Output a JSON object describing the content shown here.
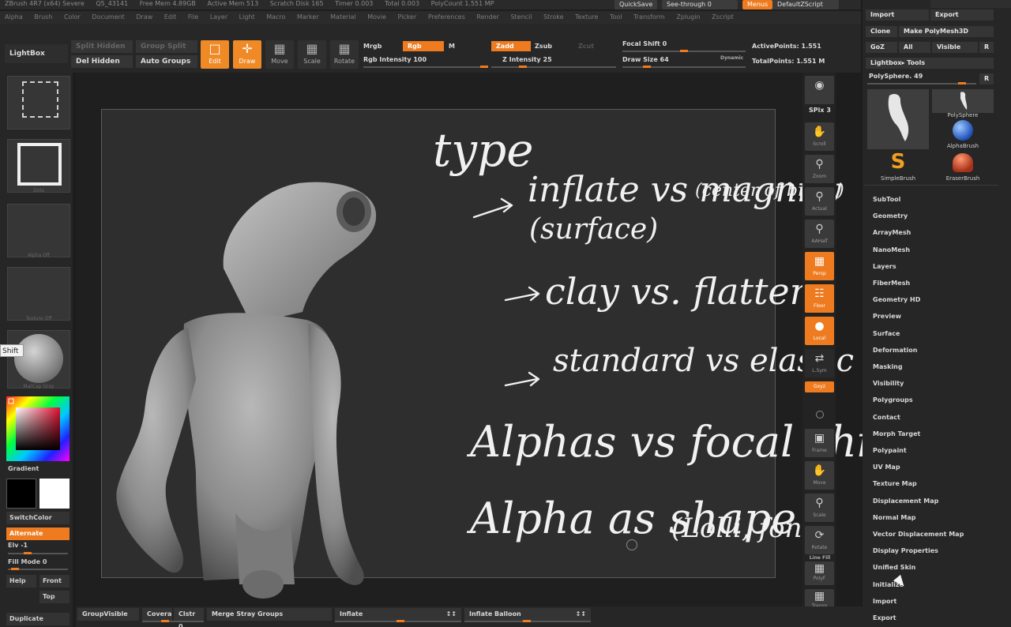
{
  "menubar": {
    "items": [
      "ZBrush 4R7 (x64) Severe",
      "Q5_43141",
      "Free Mem 4.89GB",
      "Active Mem 513",
      "Scratch Disk 165",
      "Timer 0.003",
      "Total 0.003",
      "PolyCount 1.551 MP"
    ],
    "menus": [
      "Alpha",
      "Brush",
      "Color",
      "Document",
      "Draw",
      "Edit",
      "File",
      "Layer",
      "Light",
      "Macro",
      "Marker",
      "Material",
      "Movie",
      "Picker",
      "Preferences",
      "Render",
      "Stencil",
      "Stroke",
      "Texture",
      "Tool",
      "Transform",
      "Zplugin",
      "Zscript"
    ],
    "quicksave": "QuickSave",
    "seethrough": "See-through   0",
    "menus_btn": "Menus",
    "script": "DefaultZScript"
  },
  "toolbar": {
    "lightbox": "LightBox",
    "split_hidden": "Split Hidden",
    "del_hidden": "Del Hidden",
    "group_split": "Group Split",
    "auto_groups": "Auto Groups",
    "edit": "Edit",
    "draw": "Draw",
    "move": "Move",
    "scale": "Scale",
    "rotate": "Rotate",
    "mrgb": "Mrgb",
    "rgb": "Rgb",
    "m": "M",
    "rgb_intensity": "Rgb Intensity 100",
    "zadd": "Zadd",
    "zsub": "Zsub",
    "zcut": "Zcut",
    "z_intensity": "Z Intensity 25",
    "focal_shift": "Focal Shift 0",
    "draw_size": "Draw Size 64",
    "dynamic": "Dynamic",
    "active_points": "ActivePoints: 1.551",
    "total_points": "TotalPoints: 1.551 M",
    "rgb_intensity_value": 1.0,
    "z_intensity_value": 0.25,
    "focal_shift_value": 0.5,
    "draw_size_value": 0.2
  },
  "leftshelf": {
    "tooltip": "Shift",
    "brush_cap": "Alpha Off",
    "stroke_cap": "Dots",
    "alpha_cap": "Alpha Off",
    "texture_cap": "Texture Off",
    "material_cap": "MatCap Gray",
    "gradient": "Gradient",
    "switchcolor": "SwitchColor",
    "alternate": "Alternate",
    "elv": "Elv -1",
    "fill_mode": "Fill Mode 0",
    "help": "Help",
    "front": "Front",
    "top": "Top",
    "duplicate": "Duplicate"
  },
  "viewport_tools": [
    {
      "label": "SPix 3",
      "icon": "bpr-icon"
    },
    {
      "label": "Scroll",
      "icon": "scroll-icon"
    },
    {
      "label": "Zoom",
      "icon": "zoom-icon"
    },
    {
      "label": "Actual",
      "icon": "actual-icon"
    },
    {
      "label": "AAHalf",
      "icon": "aahalf-icon"
    },
    {
      "label": "Persp",
      "icon": "persp-icon"
    },
    {
      "label": "Floor",
      "icon": "floor-icon"
    },
    {
      "label": "Local",
      "icon": "local-icon"
    },
    {
      "label": "L.Sym",
      "icon": "lsym-icon"
    },
    {
      "label": "Gxyz",
      "icon": "gxyz-icon"
    },
    {
      "label": "Frame",
      "icon": "frame-icon"
    },
    {
      "label": "Move",
      "icon": "move-icon"
    },
    {
      "label": "Scale",
      "icon": "scale-icon"
    },
    {
      "label": "Rotate",
      "icon": "rotate-icon"
    },
    {
      "label": "Line Fill",
      "icon": "linefill-icon"
    },
    {
      "label": "PolyF",
      "icon": "polyf-icon"
    },
    {
      "label": "Transp",
      "icon": "transp-icon"
    }
  ],
  "toolpanel": {
    "import": "Import",
    "export": "Export",
    "clone": "Clone",
    "make_polymesh": "Make PolyMesh3D",
    "goz": "GoZ",
    "all": "All",
    "visible": "Visible",
    "r": "R",
    "lightbox_tools": "Lightbox▸ Tools",
    "polysphere": "PolySphere. 49",
    "tools": [
      {
        "name": "PolySphere",
        "icon": "figure-tool-icon"
      },
      {
        "name": "PolySphere",
        "icon": "figure-small-icon"
      },
      {
        "name": "AlphaBrush",
        "icon": "alphabrush-icon"
      },
      {
        "name": "SimpleBrush",
        "icon": "simplebrush-icon"
      },
      {
        "name": "EraserBrush",
        "icon": "eraserbrush-icon"
      }
    ],
    "subpalettes": [
      "SubTool",
      "Geometry",
      "ArrayMesh",
      "NanoMesh",
      "Layers",
      "FiberMesh",
      "Geometry HD",
      "Preview",
      "Surface",
      "Deformation",
      "Masking",
      "Visibility",
      "Polygroups",
      "Contact",
      "Morph Target",
      "Polypaint",
      "UV Map",
      "Texture Map",
      "Displacement Map",
      "Normal Map",
      "Vector Displacement Map",
      "Display Properties",
      "Unified Skin",
      "Initialize",
      "Import",
      "Export"
    ]
  },
  "bottombar": {
    "groupvisible": "GroupVisible",
    "coverage": "Covera",
    "clstr": "Clstr 0.",
    "merge_stray": "Merge Stray Groups",
    "inflate": "Inflate",
    "inflate_balloon": "Inflate Balloon",
    "arrows": "↕↕"
  },
  "notes": {
    "line1": "type",
    "line2a": "inflate vs magnify",
    "line2b": "(surface)",
    "line2c": "(center of brush)",
    "line3": "clay vs. flatten",
    "line4": "standard vs elastic",
    "line5": "Alphas vs focal shift",
    "line6a": "Alpha as shape",
    "line6b": "(Lolli, font)"
  },
  "colors": {
    "accent": "#ee7b1f",
    "panel": "#262626",
    "canvas": "#2e2e2e"
  }
}
